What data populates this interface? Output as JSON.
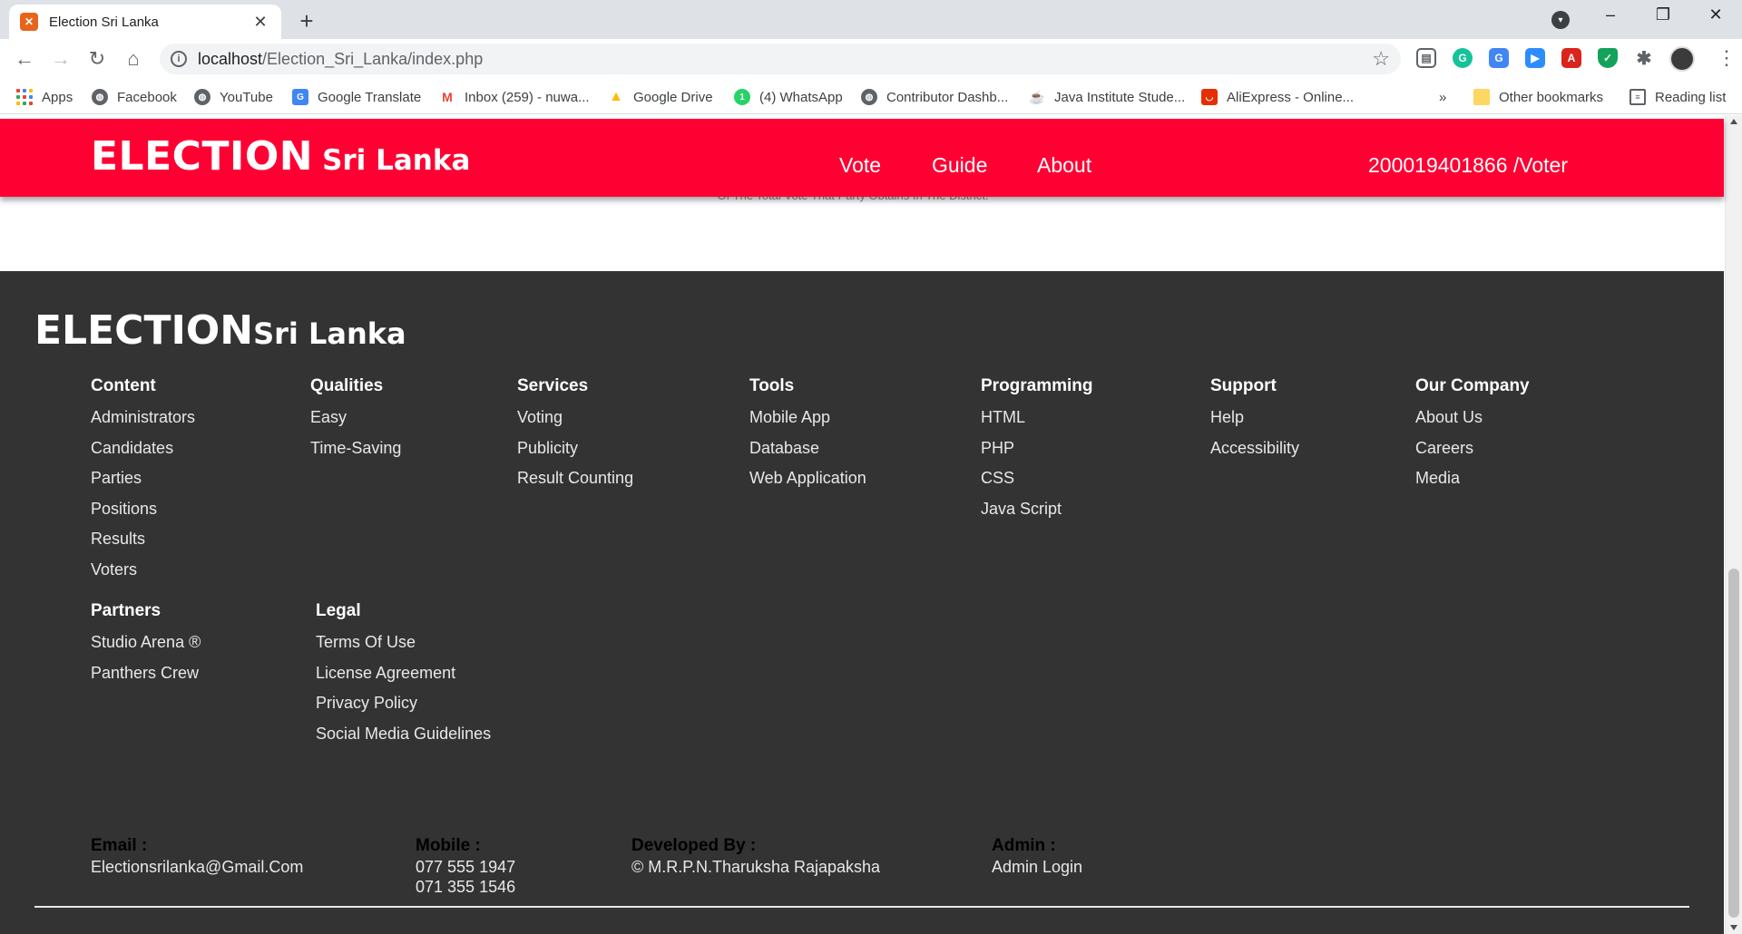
{
  "browser": {
    "tab_title": "Election Sri Lanka",
    "url_host": "localhost",
    "url_path": "/Election_Sri_Lanka/index.php",
    "bookmarks": [
      "Apps",
      "Facebook",
      "YouTube",
      "Google Translate",
      "Inbox (259) - nuwa...",
      "Google Drive",
      "(4) WhatsApp",
      "Contributor Dashb...",
      "Java Institute Stude...",
      "AliExpress - Online..."
    ],
    "bookmarks_overflow": "»",
    "other_bookmarks": "Other bookmarks",
    "reading_list": "Reading list"
  },
  "header": {
    "brand_main": "ELECTION",
    "brand_sub": "Sri Lanka",
    "nav": [
      "Vote",
      "Guide",
      "About"
    ],
    "voter_id": "200019401866 /Voter",
    "color": "#ff0033"
  },
  "page": {
    "partial_text": "Of The Total Vote That Party Obtains In The District."
  },
  "footer": {
    "brand_main": "ELECTION",
    "brand_sub": "Sri Lanka",
    "columns": [
      {
        "title": "Content",
        "links": [
          "Administrators",
          "Candidates",
          "Parties",
          "Positions",
          "Results",
          "Voters"
        ]
      },
      {
        "title": "Qualities",
        "links": [
          "Easy",
          "Time-Saving"
        ]
      },
      {
        "title": "Services",
        "links": [
          "Voting",
          "Publicity",
          "Result Counting"
        ]
      },
      {
        "title": "Tools",
        "links": [
          "Mobile App",
          "Database",
          "Web Application"
        ]
      },
      {
        "title": "Programming",
        "links": [
          "HTML",
          "PHP",
          "CSS",
          "Java Script"
        ]
      },
      {
        "title": "Support",
        "links": [
          "Help",
          "Accessibility"
        ]
      },
      {
        "title": "Our Company",
        "links": [
          "About Us",
          "Careers",
          "Media"
        ]
      },
      {
        "title": "Partners",
        "links": [
          "Studio Arena ®",
          "Panthers Crew"
        ]
      },
      {
        "title": "Legal",
        "links": [
          "Terms Of Use",
          "License Agreement",
          "Privacy Policy",
          "Social Media Guidelines"
        ]
      }
    ],
    "contact": {
      "email_label": "Email :",
      "email": "Electionsrilanka@Gmail.Com",
      "mobile_label": "Mobile :",
      "mobile_1": "077 555 1947",
      "mobile_2": "071 355 1546",
      "dev_label": "Developed By :",
      "developer": "© M.R.P.N.Tharuksha Rajapaksha",
      "admin_label": "Admin :",
      "admin_link": "Admin Login"
    },
    "background": "#333333"
  }
}
